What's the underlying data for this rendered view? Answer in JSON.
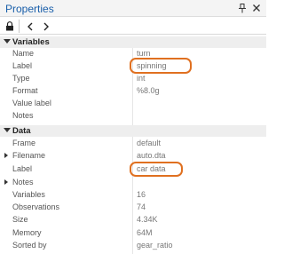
{
  "panel": {
    "title": "Properties"
  },
  "toolbar": {
    "buttons": [
      {
        "icon": "lock-icon"
      },
      {
        "icon": "back-arrow-icon"
      },
      {
        "icon": "forward-arrow-icon"
      }
    ]
  },
  "sections": {
    "variables": {
      "title": "Variables",
      "rows": [
        {
          "label": "Name",
          "value": "turn"
        },
        {
          "label": "Label",
          "value": "spinning"
        },
        {
          "label": "Type",
          "value": "int"
        },
        {
          "label": "Format",
          "value": "%8.0g"
        },
        {
          "label": "Value label",
          "value": ""
        },
        {
          "label": "Notes",
          "value": ""
        }
      ]
    },
    "data": {
      "title": "Data",
      "rows": [
        {
          "label": "Frame",
          "value": "default"
        },
        {
          "label": "Filename",
          "value": "auto.dta"
        },
        {
          "label": "Label",
          "value": "car data"
        },
        {
          "label": "Notes",
          "value": ""
        },
        {
          "label": "Variables",
          "value": "16"
        },
        {
          "label": "Observations",
          "value": "74"
        },
        {
          "label": "Size",
          "value": "4.34K"
        },
        {
          "label": "Memory",
          "value": "64M"
        },
        {
          "label": "Sorted by",
          "value": "gear_ratio"
        }
      ]
    }
  },
  "highlight_color": "#e07020",
  "title_color": "#1a5faa"
}
